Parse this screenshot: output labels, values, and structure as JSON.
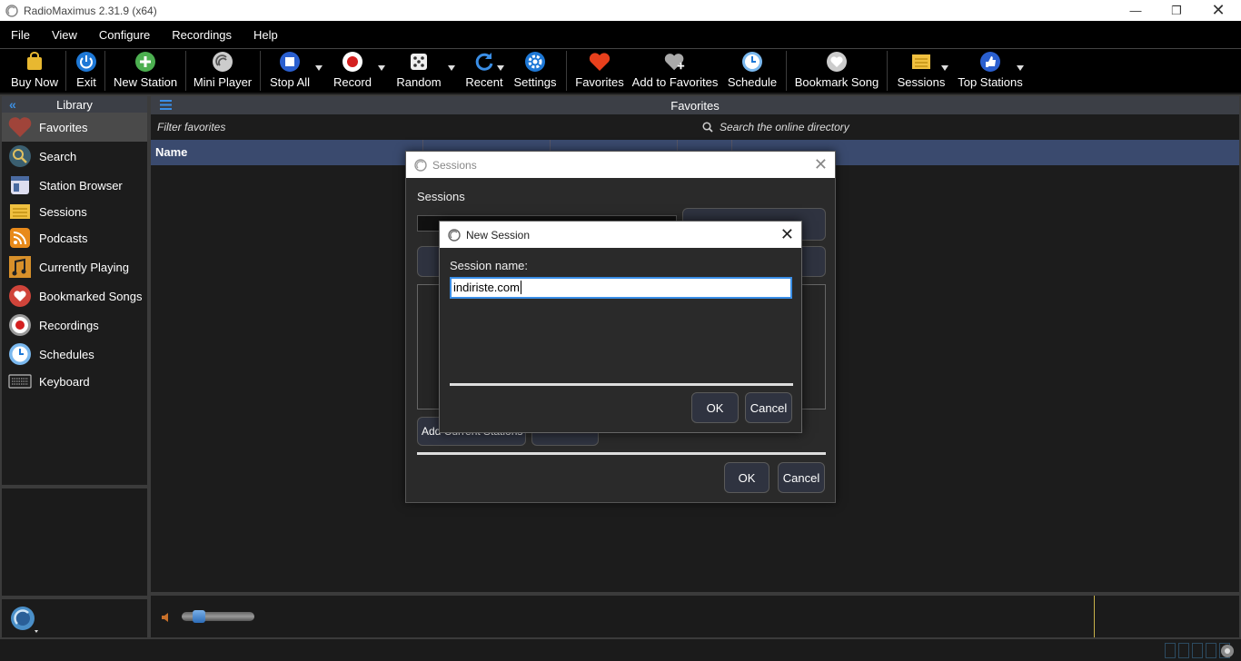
{
  "window": {
    "title": "RadioMaximus 2.31.9 (x64)"
  },
  "menu": [
    "File",
    "View",
    "Configure",
    "Recordings",
    "Help"
  ],
  "toolbar": {
    "buy_now": "Buy Now",
    "exit": "Exit",
    "new_station": "New Station",
    "mini_player": "Mini Player",
    "stop_all": "Stop All",
    "record": "Record",
    "random": "Random",
    "recent": "Recent",
    "settings": "Settings",
    "favorites": "Favorites",
    "add_to_favorites": "Add to Favorites",
    "schedule": "Schedule",
    "bookmark_song": "Bookmark Song",
    "sessions": "Sessions",
    "top_stations": "Top Stations"
  },
  "library": {
    "title": "Library",
    "items": [
      "Favorites",
      "Search",
      "Station Browser",
      "Sessions",
      "Podcasts",
      "Currently Playing",
      "Bookmarked Songs",
      "Recordings",
      "Schedules",
      "Keyboard"
    ]
  },
  "main": {
    "title": "Favorites",
    "filter_placeholder": "Filter favorites",
    "search_placeholder": "Search the online directory",
    "columns": [
      "Name"
    ]
  },
  "sessions_dialog": {
    "title": "Sessions",
    "label": "Sessions",
    "add_current_stations": "Add Current Stations",
    "ok": "OK",
    "cancel": "Cancel"
  },
  "new_session_dialog": {
    "title": "New Session",
    "label": "Session name:",
    "value": "indiriste.com",
    "ok": "OK",
    "cancel": "Cancel"
  },
  "colors": {
    "accent": "#3a8ee6",
    "panel_header": "#3c3f46",
    "table_header": "#3a4a6e",
    "background": "#1c1c1c"
  }
}
